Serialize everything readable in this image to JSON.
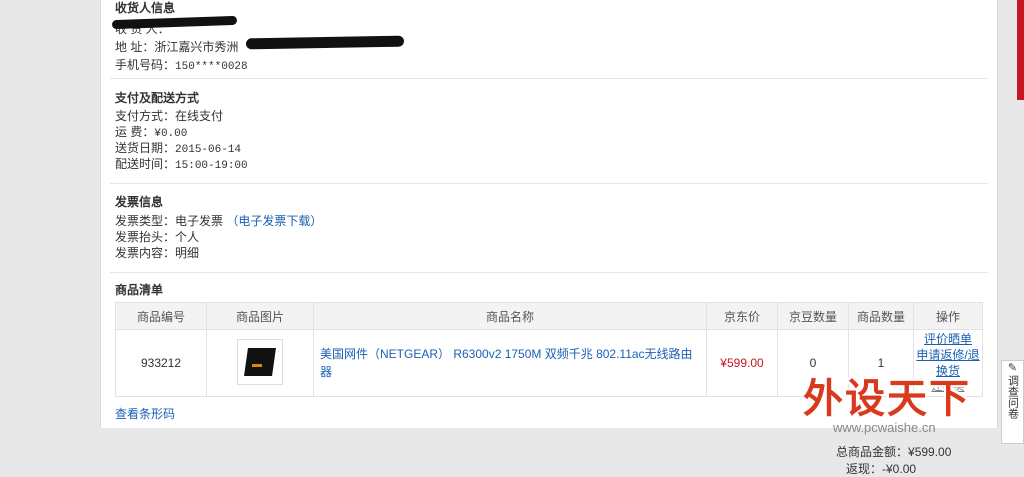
{
  "receiver": {
    "title": "收货人信息",
    "name_label": "收 货 人：",
    "addr_label": "地        址：",
    "addr_value": "浙江嘉兴市秀洲",
    "phone_label": "手机号码：",
    "phone_value": "150****0028"
  },
  "payment": {
    "title": "支付及配送方式",
    "pay_label": "支付方式：",
    "pay_value": "在线支付",
    "fee_label": "运        费：",
    "fee_value": "¥0.00",
    "date_label": "送货日期：",
    "date_value": "2015-06-14",
    "time_label": "配送时间：",
    "time_value": "15:00-19:00"
  },
  "invoice": {
    "title": "发票信息",
    "type_label": "发票类型：",
    "type_value": "电子发票",
    "download_link": "（电子发票下载）",
    "head_label": "发票抬头：",
    "head_value": "个人",
    "content_label": "发票内容：",
    "content_value": "明细"
  },
  "goods": {
    "title": "商品清单",
    "headers": [
      "商品编号",
      "商品图片",
      "商品名称",
      "京东价",
      "京豆数量",
      "商品数量",
      "操作"
    ],
    "row": {
      "sku": "933212",
      "name": "美国网件（NETGEAR） R6300v2 1750M 双频千兆 802.11ac无线路由器",
      "price": "¥599.00",
      "beans": "0",
      "qty": "1",
      "op_review": "评价晒单",
      "op_return": "申请返修/退换货",
      "op_buy": "还要买"
    },
    "barcode_link": "查看条形码"
  },
  "summary": {
    "total_label": "总商品金额：",
    "total_value": "¥599.00",
    "rebate_label": "返现：",
    "rebate_value": "-¥0.00"
  },
  "side": {
    "survey_label": "调查问卷"
  },
  "watermark": {
    "logo": "外设天下",
    "url": "www.pcwaishe.cn"
  }
}
